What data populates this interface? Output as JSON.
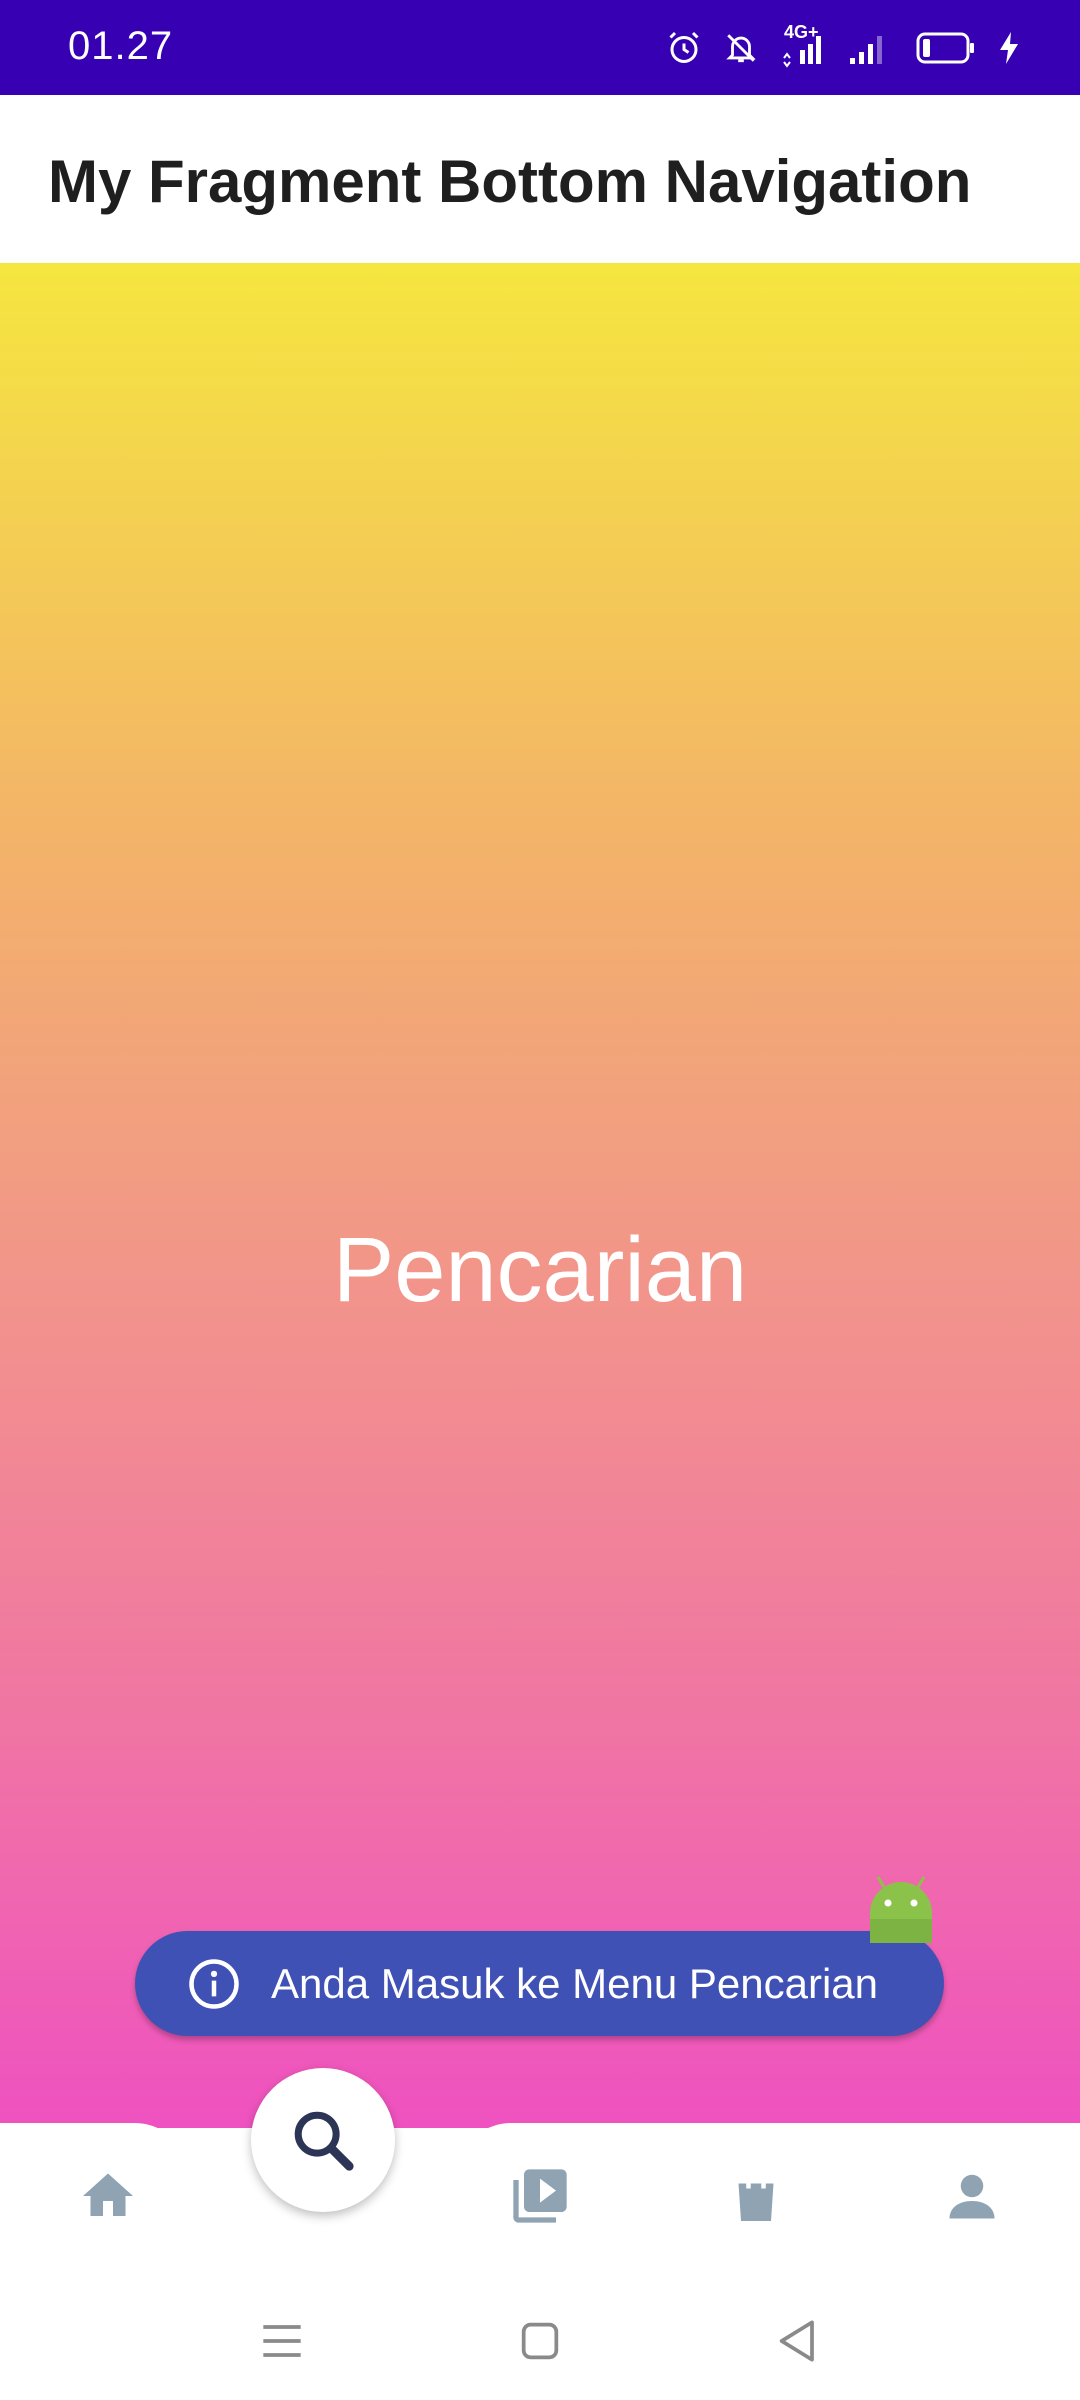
{
  "status_bar": {
    "time": "01.27",
    "network_label": "4G+",
    "icons": [
      "alarm-icon",
      "notifications-off-icon",
      "signal-4g-icon",
      "signal-icon",
      "battery-icon",
      "charging-icon"
    ]
  },
  "app_bar": {
    "title": "My Fragment Bottom Navigation"
  },
  "content": {
    "label": "Pencarian"
  },
  "toast": {
    "message": "Anda Masuk ke Menu Pencarian",
    "icon": "info-icon"
  },
  "bottom_nav": {
    "selected": "search",
    "items": [
      {
        "name": "home",
        "icon": "home-icon"
      },
      {
        "name": "search",
        "icon": "search-icon"
      },
      {
        "name": "video",
        "icon": "video-library-icon"
      },
      {
        "name": "shop",
        "icon": "shopping-bag-icon"
      },
      {
        "name": "profile",
        "icon": "person-icon"
      }
    ]
  },
  "system_nav": {
    "icons": [
      "menu-icon",
      "home-square-icon",
      "back-icon"
    ]
  },
  "colors": {
    "status_bar": "#3700B3",
    "toast_bg": "#3f51b5",
    "nav_icon": "#8fa3b3",
    "fab_icon": "#2d3557",
    "gradient_top": "#f5e63f",
    "gradient_bottom": "#ef52c0"
  }
}
